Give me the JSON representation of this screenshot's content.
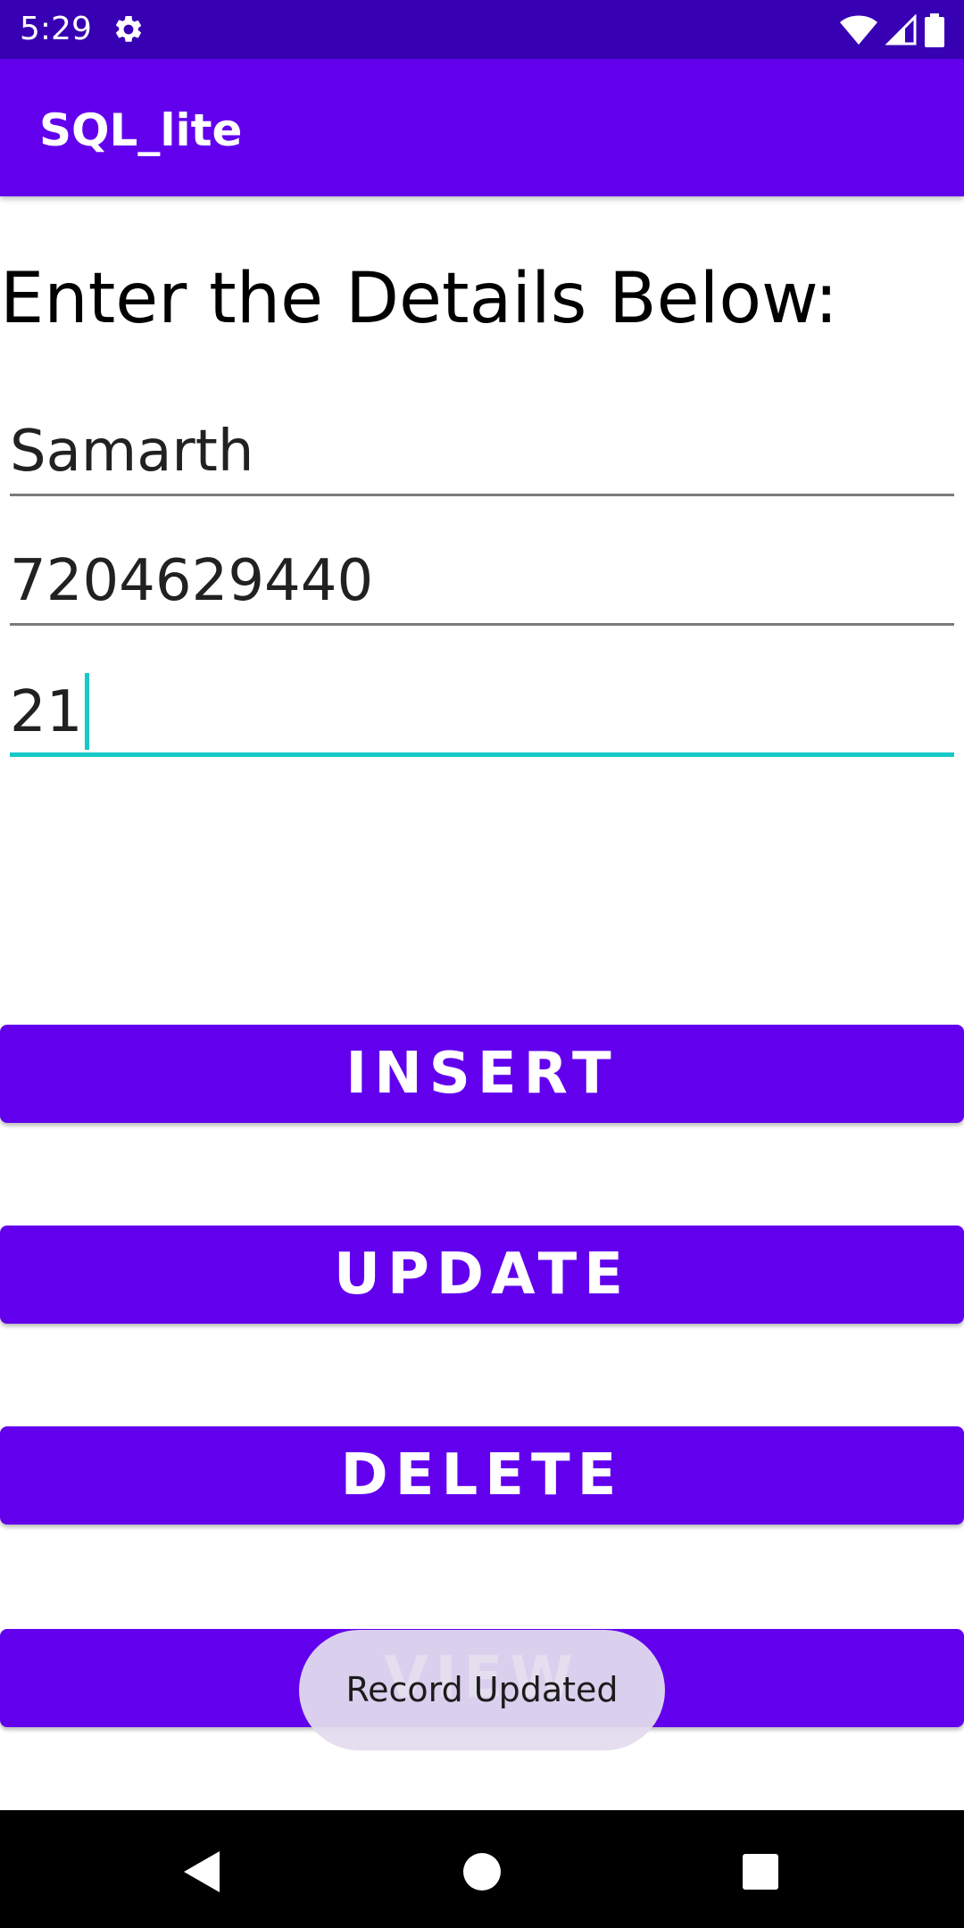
{
  "status_bar": {
    "time": "5:29",
    "icons": [
      "gear-icon",
      "wifi-icon",
      "cell-signal-icon",
      "battery-icon"
    ]
  },
  "app_bar": {
    "title": "SQL_lite"
  },
  "form": {
    "heading": "Enter the Details Below:",
    "fields": [
      {
        "value": "Samarth",
        "focused": false
      },
      {
        "value": "7204629440",
        "focused": false
      },
      {
        "value": "21",
        "focused": true
      }
    ]
  },
  "buttons": {
    "insert": "INSERT",
    "update": "UPDATE",
    "delete": "DELETE",
    "view": "VIEW"
  },
  "toast": {
    "message": "Record Updated"
  },
  "nav_bar": {
    "icons": [
      "back-icon",
      "home-icon",
      "recents-icon"
    ]
  },
  "colors": {
    "status_bar": "#3700b3",
    "primary": "#6200ee",
    "accent": "#17c8c8",
    "toast_bg": "#e2dcee"
  }
}
